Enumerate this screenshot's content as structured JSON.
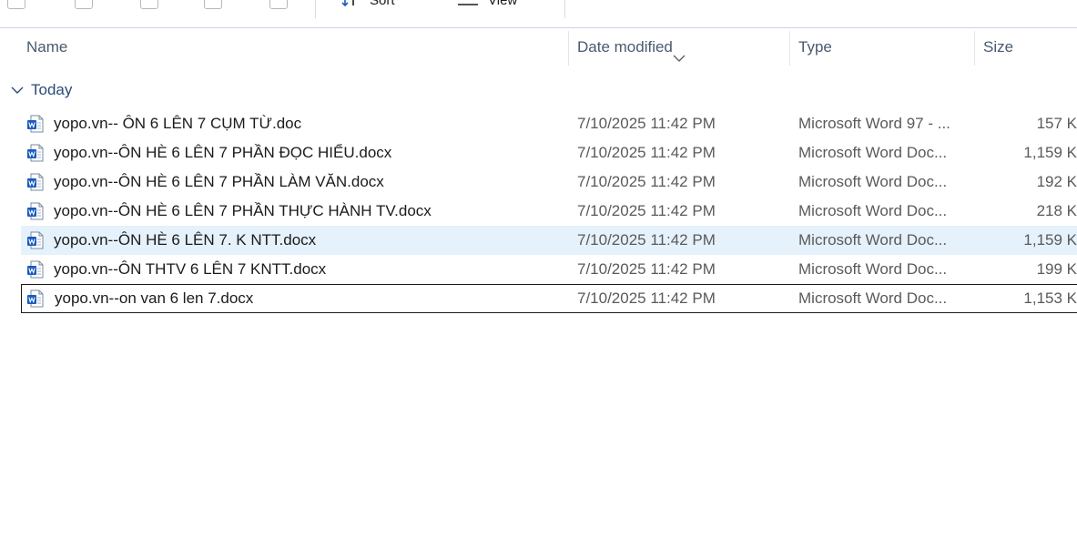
{
  "toolbar": {
    "sort_label": "Sort",
    "view_label": "View",
    "icons": [
      "copy-icon",
      "paste-icon",
      "share-icon",
      "rename-icon",
      "delete-icon",
      "sort-icon",
      "view-icon"
    ]
  },
  "columns": {
    "name": "Name",
    "date": "Date modified",
    "type": "Type",
    "size": "Size"
  },
  "group": {
    "label": "Today"
  },
  "files": [
    {
      "name": "yopo.vn-- ÔN 6 LÊN 7 CỤM TỪ.doc",
      "date": "7/10/2025 11:42 PM",
      "type": "Microsoft Word 97 - ...",
      "size": "157 K"
    },
    {
      "name": "yopo.vn--ÔN HÈ 6 LÊN 7 PHẦN ĐỌC HIỂU.docx",
      "date": "7/10/2025 11:42 PM",
      "type": "Microsoft Word Doc...",
      "size": "1,159 K"
    },
    {
      "name": "yopo.vn--ÔN HÈ 6 LÊN 7 PHẦN LÀM VĂN.docx",
      "date": "7/10/2025 11:42 PM",
      "type": "Microsoft Word Doc...",
      "size": "192 K"
    },
    {
      "name": "yopo.vn--ÔN HÈ 6 LÊN 7 PHẦN THỰC HÀNH TV.docx",
      "date": "7/10/2025 11:42 PM",
      "type": "Microsoft Word Doc...",
      "size": "218 K"
    },
    {
      "name": "yopo.vn--ÔN HÈ 6 LÊN 7. K NTT.docx",
      "date": "7/10/2025 11:42 PM",
      "type": "Microsoft Word Doc...",
      "size": "1,159 K"
    },
    {
      "name": "yopo.vn--ÔN THTV 6 LÊN 7 KNTT.docx",
      "date": "7/10/2025 11:42 PM",
      "type": "Microsoft Word Doc...",
      "size": "199 K"
    },
    {
      "name": "yopo.vn--on van 6 len 7.docx",
      "date": "7/10/2025 11:42 PM",
      "type": "Microsoft Word Doc...",
      "size": "1,153 K"
    }
  ],
  "colors": {
    "hover_row": "#e5f1fb",
    "word_blue": "#185abd",
    "group_label": "#2c4a7a"
  }
}
